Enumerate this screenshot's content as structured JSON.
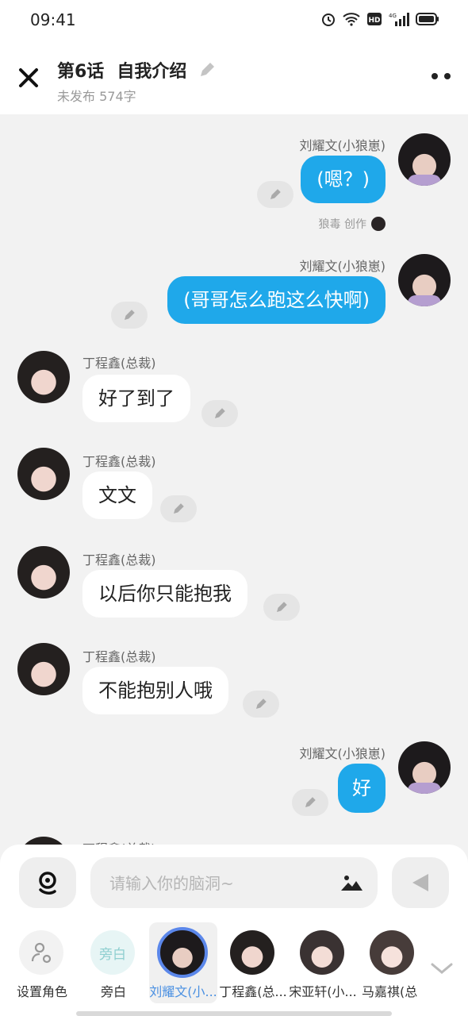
{
  "status": {
    "time": "09:41",
    "network": "4G",
    "hd": "HD"
  },
  "header": {
    "episode": "第6话",
    "chapter_title": "自我介绍",
    "subline": "未发布 574字"
  },
  "messages": [
    {
      "side": "right",
      "speaker": "刘耀文(小狼崽)",
      "text": "(嗯？)",
      "avatar": "liu",
      "credit": "狼毒 创作"
    },
    {
      "side": "right",
      "speaker": "刘耀文(小狼崽)",
      "text": "(哥哥怎么跑这么快啊)",
      "avatar": "liu"
    },
    {
      "side": "left",
      "speaker": "丁程鑫(总裁)",
      "text": "好了到了",
      "avatar": "ding"
    },
    {
      "side": "left",
      "speaker": "丁程鑫(总裁)",
      "text": "文文",
      "avatar": "ding"
    },
    {
      "side": "left",
      "speaker": "丁程鑫(总裁)",
      "text": "以后你只能抱我",
      "avatar": "ding"
    },
    {
      "side": "left",
      "speaker": "丁程鑫(总裁)",
      "text": "不能抱别人哦",
      "avatar": "ding"
    },
    {
      "side": "right",
      "speaker": "刘耀文(小狼崽)",
      "text": "好",
      "avatar": "liu"
    },
    {
      "side": "left",
      "speaker": "丁程鑫(总裁)",
      "text": "",
      "avatar": "ding"
    }
  ],
  "composer": {
    "placeholder": "请输入你的脑洞~"
  },
  "roles": [
    {
      "label": "设置角色",
      "kind": "set"
    },
    {
      "label": "旁白",
      "kind": "narrator",
      "badge": "旁白"
    },
    {
      "label": "刘耀文(小...",
      "kind": "liu",
      "active": true
    },
    {
      "label": "丁程鑫(总...",
      "kind": "ding"
    },
    {
      "label": "宋亚轩(小...",
      "kind": "song"
    },
    {
      "label": "马嘉祺(总",
      "kind": "ma"
    }
  ],
  "colors": {
    "accent": "#1fa8ea",
    "active_role": "#4a90e2"
  }
}
